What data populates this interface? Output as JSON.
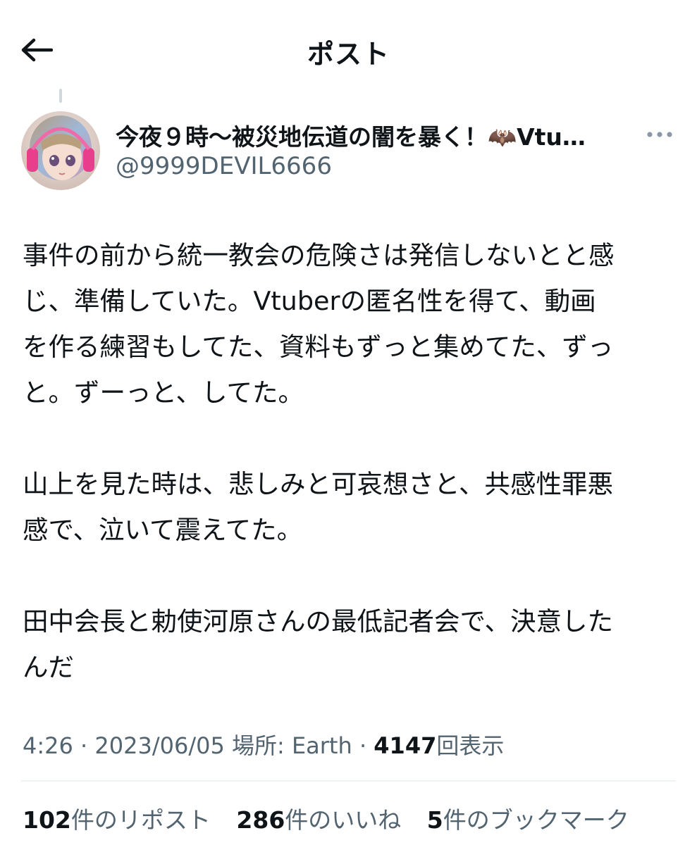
{
  "header": {
    "title": "ポスト"
  },
  "user": {
    "display_name": "今夜９時〜被災地伝道の闇を暴く！🦇Vtu…",
    "handle": "@9999DEVIL6666"
  },
  "tweet": {
    "paragraphs": [
      [
        "事件の前から統一教会の危険さは発信しないとと感",
        "じ、準備していた。Vtuberの匿名性を得て、動画",
        "を作る練習もしてた、資料もずっと集めてた、ずっ",
        "と。ずーっと、してた。"
      ],
      [
        "山上を見た時は、悲しみと可哀想さと、共感性罪悪",
        "感で、泣いて震えてた。"
      ],
      [
        "田中会長と勅使河原さんの最低記者会で、決意した",
        "んだ"
      ]
    ]
  },
  "meta": {
    "time": "4:26",
    "separator": "·",
    "date": "2023/06/05",
    "location_label": "場所: Earth",
    "views_count": "4147",
    "views_label": "回表示"
  },
  "stats": {
    "reposts_count": "102",
    "reposts_label": "件のリポスト",
    "likes_count": "286",
    "likes_label": "件のいいね",
    "bookmarks_count": "5",
    "bookmarks_label": "件のブックマーク"
  },
  "colors": {
    "text": "#0f1419",
    "secondary": "#536471",
    "divider": "#eff3f4"
  },
  "icons": {
    "back": "arrow-left-icon",
    "more": "more-horizontal-icon"
  }
}
